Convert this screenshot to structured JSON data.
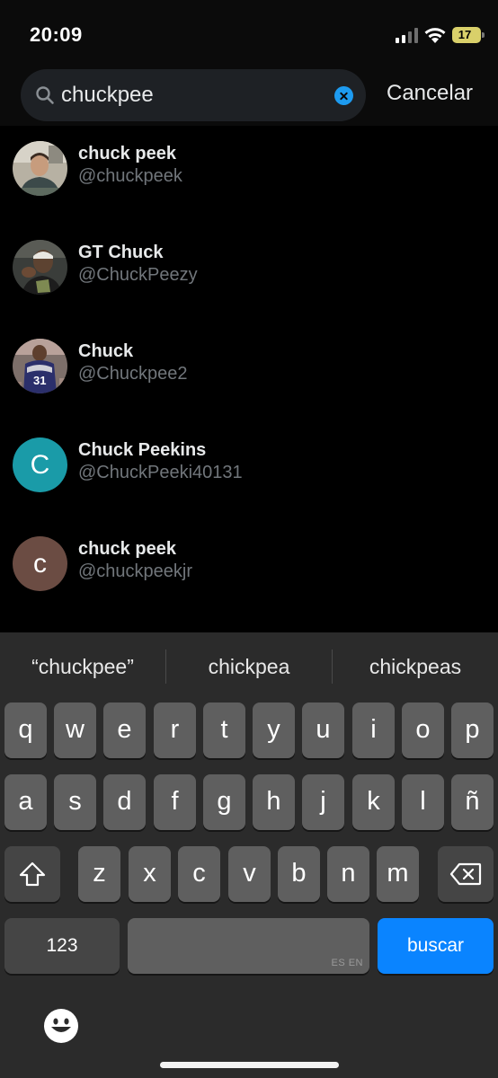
{
  "status_bar": {
    "time": "20:09",
    "battery_level": "17",
    "battery_color": "#d9d06a",
    "icons": [
      "cellular-signal-icon",
      "wifi-icon",
      "battery-icon"
    ]
  },
  "search": {
    "query": "chuckpee",
    "cancel_label": "Cancelar",
    "accent_color": "#1d9bf0"
  },
  "results": [
    {
      "name": "chuck peek",
      "handle": "@chuckpeek",
      "avatar": "photo"
    },
    {
      "name": "GT Chuck",
      "handle": "@ChuckPeezy",
      "avatar": "photo"
    },
    {
      "name": "Chuck",
      "handle": "@Chuckpee2",
      "avatar": "photo"
    },
    {
      "name": "Chuck Peekins",
      "handle": "@ChuckPeeki40131",
      "avatar": "C",
      "avatar_color": "#1a9ba8"
    },
    {
      "name": "chuck peek",
      "handle": "@chuckpeekjr",
      "avatar": "c",
      "avatar_color": "#6b4c43"
    }
  ],
  "keyboard": {
    "suggestions": [
      "“chuckpee”",
      "chickpea",
      "chickpeas"
    ],
    "row1": [
      "q",
      "w",
      "e",
      "r",
      "t",
      "y",
      "u",
      "i",
      "o",
      "p"
    ],
    "row2": [
      "a",
      "s",
      "d",
      "f",
      "g",
      "h",
      "j",
      "k",
      "l",
      "ñ"
    ],
    "row3": [
      "z",
      "x",
      "c",
      "v",
      "b",
      "n",
      "m"
    ],
    "numbers_label": "123",
    "language_hint": "ES EN",
    "return_label": "buscar",
    "return_color": "#0a84ff",
    "icons": [
      "shift-icon",
      "delete-icon",
      "emoji-icon"
    ]
  }
}
